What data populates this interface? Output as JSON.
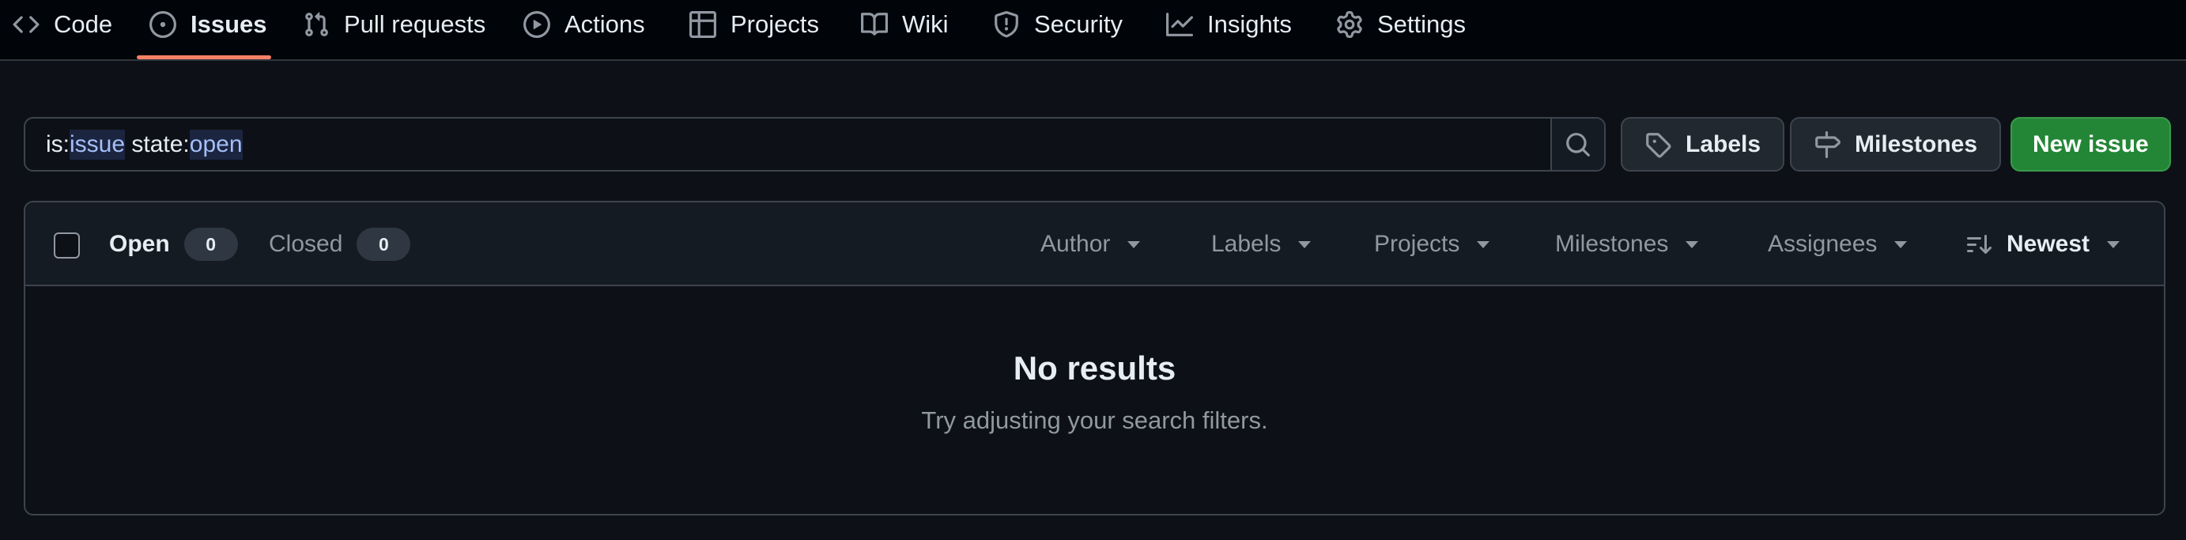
{
  "nav": {
    "items": [
      {
        "label": "Code",
        "icon": "code-icon"
      },
      {
        "label": "Issues",
        "icon": "issue-opened-icon",
        "active": true
      },
      {
        "label": "Pull requests",
        "icon": "git-pull-request-icon"
      },
      {
        "label": "Actions",
        "icon": "play-icon"
      },
      {
        "label": "Projects",
        "icon": "table-icon"
      },
      {
        "label": "Wiki",
        "icon": "book-icon"
      },
      {
        "label": "Security",
        "icon": "shield-icon"
      },
      {
        "label": "Insights",
        "icon": "graph-icon"
      },
      {
        "label": "Settings",
        "icon": "gear-icon"
      }
    ]
  },
  "search": {
    "parts": [
      {
        "text": "is:",
        "token": false
      },
      {
        "text": "issue",
        "token": true
      },
      {
        "text": " state:",
        "token": false
      },
      {
        "text": "open",
        "token": true
      }
    ],
    "button_icon": "search-icon"
  },
  "toolbar": {
    "labels_label": "Labels",
    "milestones_label": "Milestones",
    "new_issue_label": "New issue"
  },
  "list_header": {
    "open_label": "Open",
    "open_count": "0",
    "closed_label": "Closed",
    "closed_count": "0",
    "filters": {
      "author": "Author",
      "labels": "Labels",
      "projects": "Projects",
      "milestones": "Milestones",
      "assignees": "Assignees"
    },
    "sort_label": "Newest"
  },
  "empty_state": {
    "title": "No results",
    "subtitle": "Try adjusting your search filters."
  },
  "colors": {
    "accent_underline": "#f78166",
    "primary_button": "#238636",
    "token_highlight": "#a5bff7"
  }
}
